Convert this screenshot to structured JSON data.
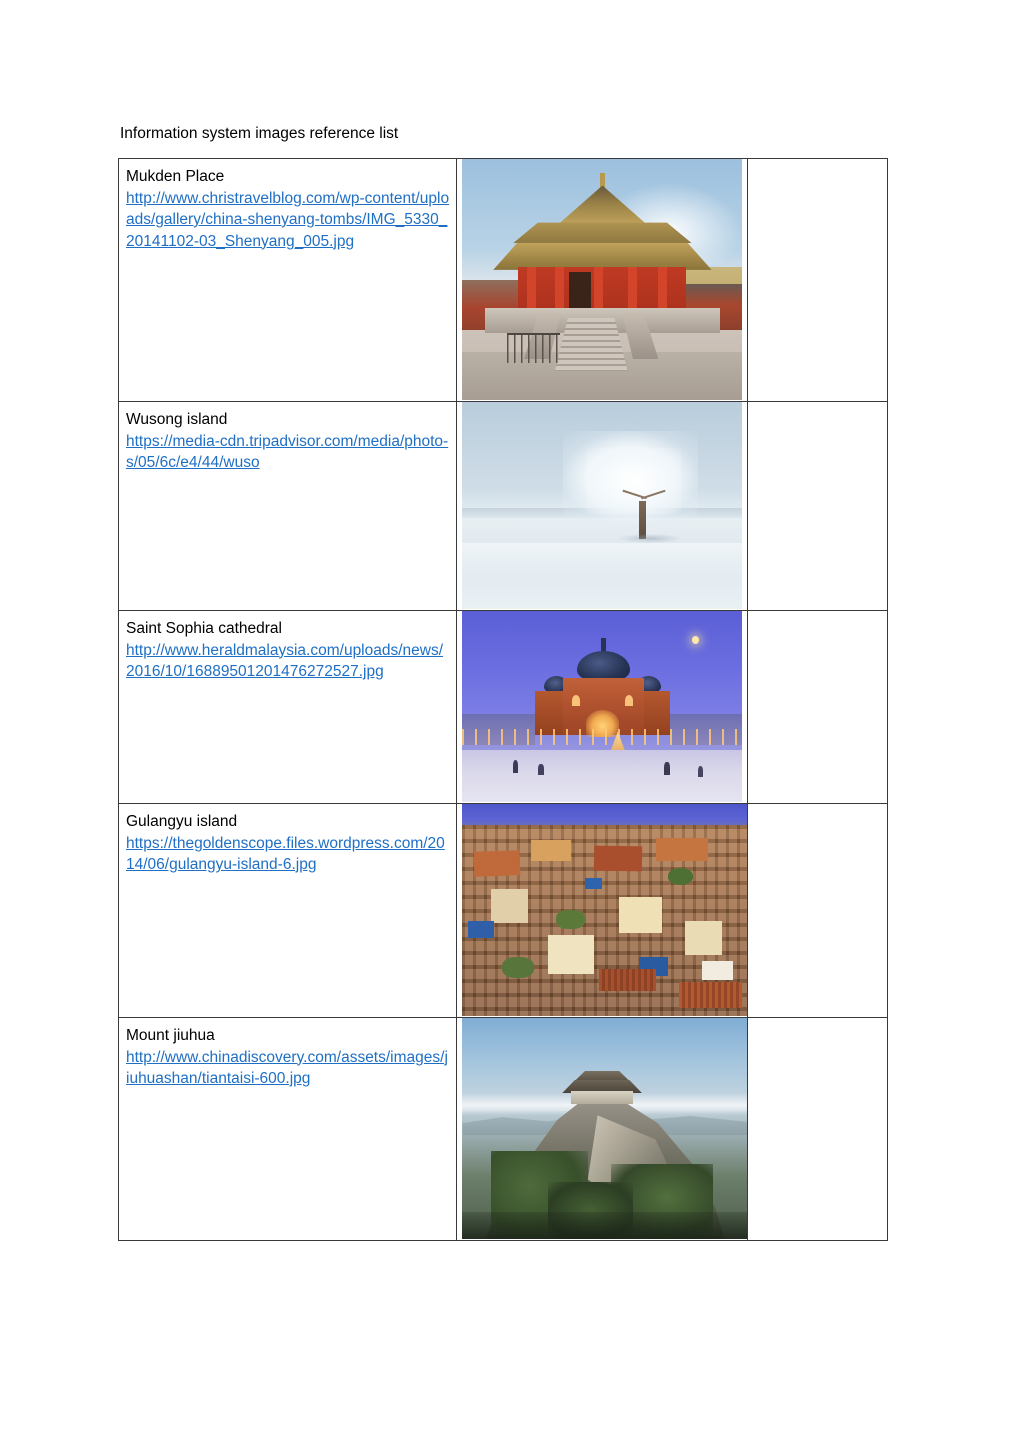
{
  "document": {
    "title": "Information system images reference list"
  },
  "table": {
    "rows": [
      {
        "name": "Mukden Place",
        "url": "http://www.christravelblog.com/wp-content/uploads/gallery/china-shenyang-tombs/IMG_5330_20141102-03_Shenyang_005.jpg",
        "image_alt": "Mukden Palace hall with golden roof and red columns",
        "image_class": "ph-mukden"
      },
      {
        "name": "Wusong island",
        "url": "https://media-cdn.tripadvisor.com/media/photo-s/05/6c/e4/44/wuso",
        "image_alt": "Frost covered tree on snowy plain at Wusong island",
        "image_class": "ph-wusong"
      },
      {
        "name": "Saint Sophia cathedral",
        "url": "http://www.heraldmalaysia.com/uploads/news/2016/10/16889501201476272527.jpg",
        "image_alt": "Saint Sophia cathedral illuminated at blue hour in snow",
        "image_class": "ph-sophia"
      },
      {
        "name": "Gulangyu island",
        "url": "https://thegoldenscope.files.wordpress.com/2014/06/gulangyu-island-6.jpg",
        "image_alt": "Dense colourful rooftops of Gulangyu island",
        "image_class": "ph-gulangyu"
      },
      {
        "name": "Mount jiuhua",
        "url": "http://www.chinadiscovery.com/assets/images/jiuhuashan/tiantaisi-600.jpg",
        "image_alt": "Temple on the rocky peak of Mount Jiuhua",
        "image_class": "ph-jiuhua"
      }
    ]
  },
  "colors": {
    "hyperlink": "#1f6fc5",
    "text": "#000000",
    "border": "#3a3a3a",
    "page_background": "#ffffff"
  }
}
